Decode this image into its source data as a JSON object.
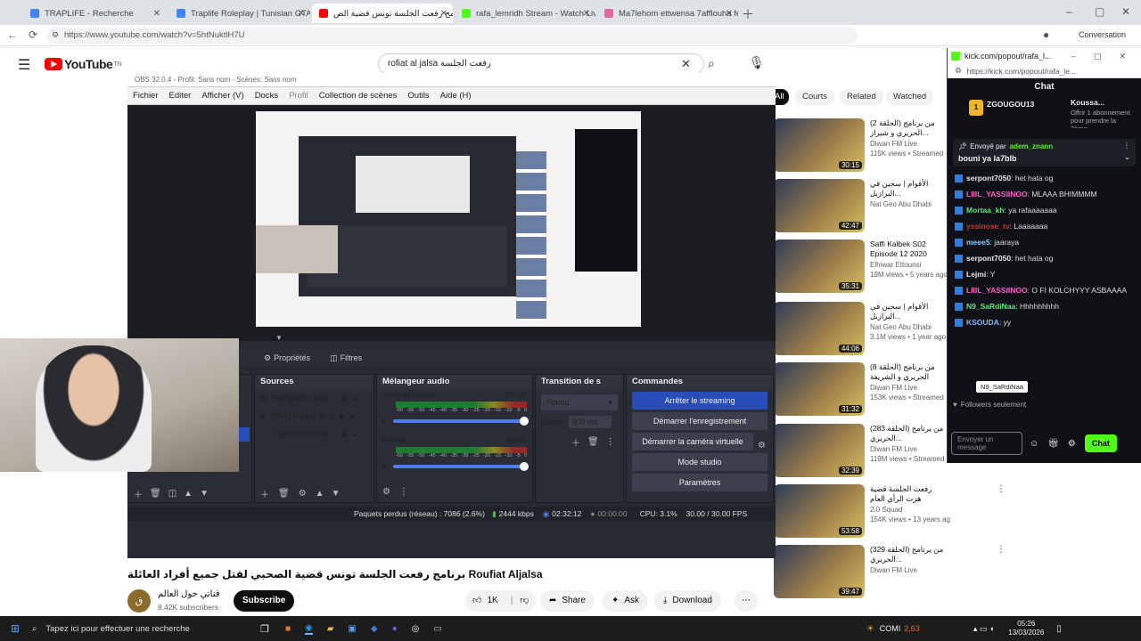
{
  "browser": {
    "tabs": [
      {
        "label": "TRAPLIFE - Recherche",
        "active": false
      },
      {
        "label": "Traplife Roleplay | Tunisian GTA V",
        "active": false
      },
      {
        "label": "برنامج رفعت الجلسة تونس قضية الص",
        "active": true
      },
      {
        "label": "rafa_lemridh Stream - Watch Live",
        "active": false
      },
      {
        "label": "Ma7lehom ettwensa 7afflouha fel",
        "active": false
      }
    ],
    "url": "https://www.youtube.com/watch?v=5htNuktlH7U",
    "conversation_label": "Conversation"
  },
  "youtube": {
    "logo_text": "YouTube",
    "logo_suffix": "TN",
    "search_value": "rofiat al jalsa رفعت الجلسة",
    "filter_chips": [
      "All",
      "Courts",
      "Related",
      "Watched"
    ],
    "video_title": "برنامج رفعت الجلسة تونس قضية الصحبي لقتل جميع أفراد العائلة Roufiat Aljalsa",
    "channel_name": "قناتي حول العالم",
    "subscribers": "8.42K subscribers",
    "subscribe_label": "Subscribe",
    "like_count": "1K",
    "share_label": "Share",
    "ask_label": "Ask",
    "download_label": "Download",
    "recommendations": [
      {
        "title": "(الحلقة 2) من برنامج الحريري و شيراز...",
        "channel": "Diwan FM Live",
        "meta": "115K views • Streamed",
        "duration": "30:15"
      },
      {
        "title": "الأقوام | سجين في البرازيل...",
        "channel": "Nat Geo Abu Dhabi",
        "meta": "",
        "duration": "42:47"
      },
      {
        "title": "Saffi Kalbek S02 Episode 12 2020 Partie 02",
        "channel": "Elhiwar Ettounsi",
        "meta": "19M views • 5 years ago",
        "duration": "35:31"
      },
      {
        "title": "الأقوام | سجين في البرازيل...",
        "channel": "Nat Geo Abu Dhabi",
        "meta": "3.1M views • 1 year ago",
        "duration": "44:06"
      },
      {
        "title": "(الحلقة 8) من برنامج الحريري و الشريفة",
        "channel": "Diwan FM Live",
        "meta": "153K views • Streamed",
        "duration": "31:32"
      },
      {
        "title": "(الحلقة 283) من برنامج الحريري...",
        "channel": "Diwan FM Live",
        "meta": "119M views • Streamed",
        "duration": "32:39"
      },
      {
        "title": "رفعت الجلسة قضية هزت الرأي العام",
        "channel": "2.0 Squad",
        "meta": "154K views • 13 years ago",
        "duration": "53:58"
      },
      {
        "title": "(الحلقة 329) من برنامج الحريري...",
        "channel": "Diwan FM Live",
        "meta": "",
        "duration": "39:47"
      }
    ]
  },
  "obs": {
    "window_title": "OBS 32.0.4 - Profil: Sans nom - Scènes: Sans nom",
    "menu": [
      "Fichier",
      "Editer",
      "Afficher (V)",
      "Docks",
      "Profil",
      "Collection de scènes",
      "Outils",
      "Aide (H)"
    ],
    "props_label": "Propriétés",
    "filters_label": "Filtres",
    "sources_title": "Sources",
    "sources": [
      "Navigateur web",
      "Périphérique de ca",
      "Capture d'écran"
    ],
    "mixer_title": "Mélangeur audio",
    "channels": [
      {
        "name": "Audio du bureau",
        "db": "0.0 dB"
      },
      {
        "name": "Mic/Aux",
        "db": "0.0 dB"
      }
    ],
    "meter_ticks": [
      "-60",
      "-55",
      "-50",
      "-45",
      "-40",
      "-35",
      "-30",
      "-25",
      "-20",
      "-15",
      "-10",
      "-5",
      "0"
    ],
    "transitions_title": "Transition de s",
    "transition_value": "Fondu",
    "duration_label": "Durée",
    "duration_value": "300 ms",
    "controls_title": "Commandes",
    "controls": [
      "Arrêter le streaming",
      "Démarrer l'enregistrement",
      "Démarrer la caméra virtuelle",
      "Mode studio",
      "Paramètres"
    ],
    "status": {
      "dropped": "Paquets perdus (réseau) : 7086 (2.6%)",
      "bitrate": "2444 kbps",
      "stream_time": "02:32:12",
      "rec_time": "00:00:00",
      "cpu": "CPU: 3.1%",
      "fps": "30.00 / 30.00 FPS"
    }
  },
  "kick": {
    "url": "kick.com/popout/rafa_l...",
    "full_url": "https://kick.com/popout/rafa_le...",
    "title": "Chat",
    "gift": {
      "user": "ZGOUGOU13",
      "count": "1",
      "text": "Offrir 1 abonnement pour prendre la 3ème",
      "top_user": "Koussa..."
    },
    "pinned_by_label": "Envoyé par",
    "pinned_by": "adem_znann",
    "pinned_text": "bouni ya la7blb",
    "messages": [
      {
        "user": "serpont7050",
        "text": "het hata og",
        "color": "#e6e6e6"
      },
      {
        "user": "LIIIL_YASSIINOO",
        "text": "MLAAA BHIMMMM",
        "color": "#ff5ec4"
      },
      {
        "user": "Mortaa_kh",
        "text": "ya rafaaaaaaa",
        "color": "#62e27f"
      },
      {
        "user": "yssinose_tv",
        "text": "Laaaaaaa",
        "color": "#c03b3b"
      },
      {
        "user": "meee5",
        "text": "jaaraya",
        "color": "#7fd1ff"
      },
      {
        "user": "serpont7050",
        "text": "het hata og",
        "color": "#e6e6e6"
      },
      {
        "user": "Lejmi",
        "text": "Y",
        "color": "#e6e6e6"
      },
      {
        "user": "LIIIL_YASSIINOO",
        "text": "O FI KOLCHYYY ASBAAAA",
        "color": "#ff5ec4"
      },
      {
        "user": "N9_SaRdiNaa",
        "text": "Hhhhhhhhh",
        "color": "#62e27f"
      },
      {
        "user": "KSOUDA",
        "text": "yy",
        "color": "#7fb3ff"
      }
    ],
    "tooltip": "N9_SaRdiNaa",
    "followers_only": "Followers seulement",
    "send_placeholder": "Envoyer un message",
    "chat_button": "Chat"
  },
  "taskbar": {
    "search_placeholder": "Tapez ici pour effectuer une recherche",
    "weather": "COMI",
    "temperature": "2,63",
    "time": "05:26",
    "date": "13/03/2026"
  },
  "colors": {
    "kick_green": "#53fc18",
    "obs_primary": "#284cb8",
    "youtube_red": "#ff0000"
  }
}
